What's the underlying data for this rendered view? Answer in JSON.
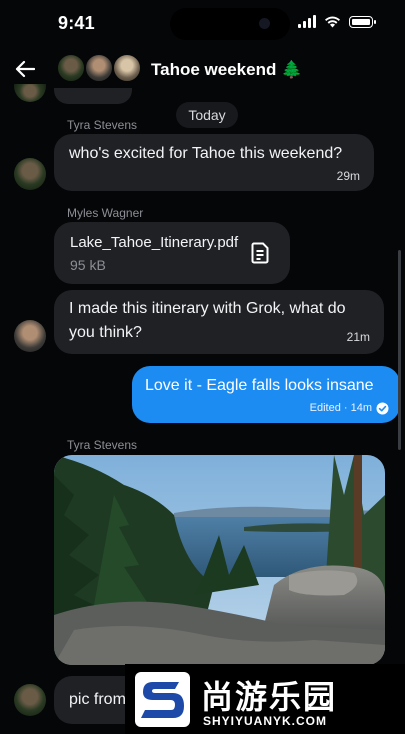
{
  "status_bar": {
    "time": "9:41"
  },
  "header": {
    "title": "Tahoe weekend 🌲"
  },
  "chat": {
    "date_separator": "Today",
    "messages": [
      {
        "sender": "Tyra Stevens",
        "text": "who's excited for Tahoe this weekend?",
        "time": "29m"
      },
      {
        "sender": "Myles Wagner",
        "file_name": "Lake_Tahoe_Itinerary.pdf",
        "file_size": "95 kB"
      },
      {
        "text": "I made this itinerary with Grok, what do you think?",
        "time": "21m"
      },
      {
        "text": "Love it - Eagle falls looks insane",
        "status": "Edited · 14m"
      },
      {
        "sender": "Tyra Stevens"
      },
      {
        "text": "pic from"
      }
    ]
  },
  "watermark": {
    "text": "尚游乐园",
    "url": "SHYIYUANYK.COM"
  },
  "colors": {
    "background": "#050608",
    "incoming_bubble": "#1f2125",
    "outgoing_bubble": "#1d8cf2",
    "watermark_blue": "#1d4aa8"
  }
}
